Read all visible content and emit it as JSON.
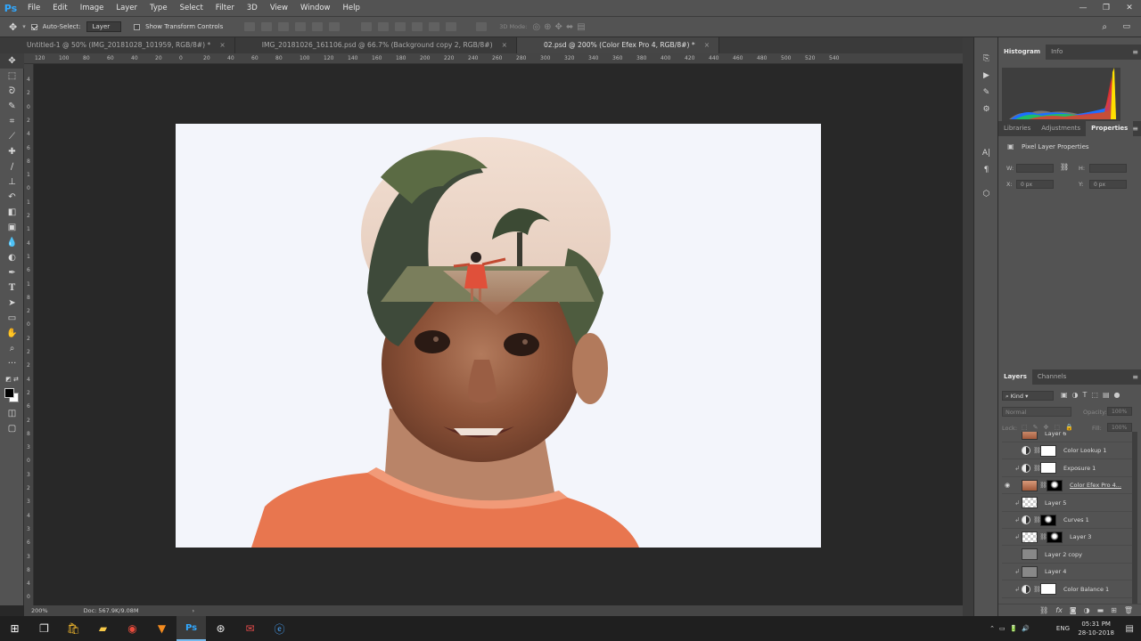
{
  "app": {
    "logo": "Ps"
  },
  "menu": [
    "File",
    "Edit",
    "Image",
    "Layer",
    "Type",
    "Select",
    "Filter",
    "3D",
    "View",
    "Window",
    "Help"
  ],
  "options": {
    "auto_select_label": "Auto-Select:",
    "auto_select_value": "Layer",
    "show_transform_label": "Show Transform Controls",
    "mode_3d": "3D Mode:"
  },
  "tabs": [
    {
      "label": "Untitled-1 @ 50% (IMG_20181028_101959, RGB/8#) *",
      "close": "×"
    },
    {
      "label": "IMG_20181026_161106.psd @ 66.7% (Background copy 2, RGB/8#)",
      "close": "×"
    },
    {
      "label": "02.psd @ 200% (Color Efex Pro 4, RGB/8#) *",
      "close": "×"
    }
  ],
  "ruler_h": [
    "120",
    "100",
    "80",
    "60",
    "40",
    "20",
    "0",
    "20",
    "40",
    "60",
    "80",
    "100",
    "120",
    "140",
    "160",
    "180",
    "200",
    "220",
    "240",
    "260",
    "280",
    "300",
    "320",
    "340",
    "360",
    "380",
    "400",
    "420",
    "440",
    "460",
    "480",
    "500",
    "520",
    "540"
  ],
  "ruler_v": [
    "4",
    "2",
    "0",
    "2",
    "4",
    "6",
    "8",
    "1",
    "0",
    "1",
    "2",
    "1",
    "4",
    "1",
    "6",
    "1",
    "8",
    "2",
    "0",
    "2",
    "2",
    "2",
    "4",
    "2",
    "6",
    "2",
    "8",
    "3",
    "0",
    "3",
    "2",
    "3",
    "4",
    "3",
    "6",
    "3",
    "8",
    "4",
    "0"
  ],
  "status": {
    "zoom": "200%",
    "doc": "Doc: 567.9K/9.08M",
    "arrow": "›"
  },
  "panels": {
    "histogram_tabs": [
      "Histogram",
      "Info"
    ],
    "props_tabs": [
      "Libraries",
      "Adjustments",
      "Properties"
    ],
    "props_title": "Pixel Layer Properties",
    "w_label": "W:",
    "h_label": "H:",
    "x_label": "X:",
    "y_label": "Y:",
    "x_value": "0 px",
    "y_value": "0 px",
    "layers_tabs": [
      "Layers",
      "Channels"
    ],
    "kind_label": "Kind",
    "blend_mode": "Normal",
    "opacity_label": "Opacity:",
    "opacity_value": "100%",
    "lock_label": "Lock:",
    "fill_label": "Fill:",
    "fill_value": "100%"
  },
  "layers": [
    {
      "name": "Layer 6",
      "thumb": "photo",
      "adj": false,
      "clip": false,
      "mask": false,
      "visible": false,
      "selected": false
    },
    {
      "name": "Color Lookup 1",
      "thumb": "white",
      "adj": true,
      "clip": false,
      "mask": true,
      "visible": false,
      "selected": false
    },
    {
      "name": "Exposure 1",
      "thumb": "white",
      "adj": true,
      "clip": true,
      "mask": true,
      "visible": false,
      "selected": false
    },
    {
      "name": "Color Efex Pro 4...",
      "thumb": "photo",
      "adj": false,
      "clip": false,
      "mask": true,
      "visible": true,
      "selected": false
    },
    {
      "name": "Layer 5",
      "thumb": "checker",
      "adj": false,
      "clip": true,
      "mask": false,
      "visible": false,
      "selected": false
    },
    {
      "name": "Curves 1",
      "thumb": "black",
      "adj": true,
      "clip": true,
      "mask": true,
      "visible": false,
      "selected": false
    },
    {
      "name": "Layer 3",
      "thumb": "checker",
      "adj": false,
      "clip": true,
      "mask": true,
      "visible": false,
      "selected": false
    },
    {
      "name": "Layer 2 copy",
      "thumb": "grey",
      "adj": false,
      "clip": false,
      "mask": false,
      "visible": false,
      "selected": false
    },
    {
      "name": "Layer 4",
      "thumb": "grey",
      "adj": false,
      "clip": true,
      "mask": false,
      "visible": false,
      "selected": false
    },
    {
      "name": "Color Balance 1",
      "thumb": "white",
      "adj": true,
      "clip": true,
      "mask": true,
      "visible": false,
      "selected": false
    }
  ],
  "taskbar": {
    "lang": "ENG",
    "time": "05:31 PM",
    "date": "28-10-2018"
  },
  "colors": {
    "accent": "#31a8ff",
    "panel": "#535353",
    "canvas": "#282828"
  }
}
